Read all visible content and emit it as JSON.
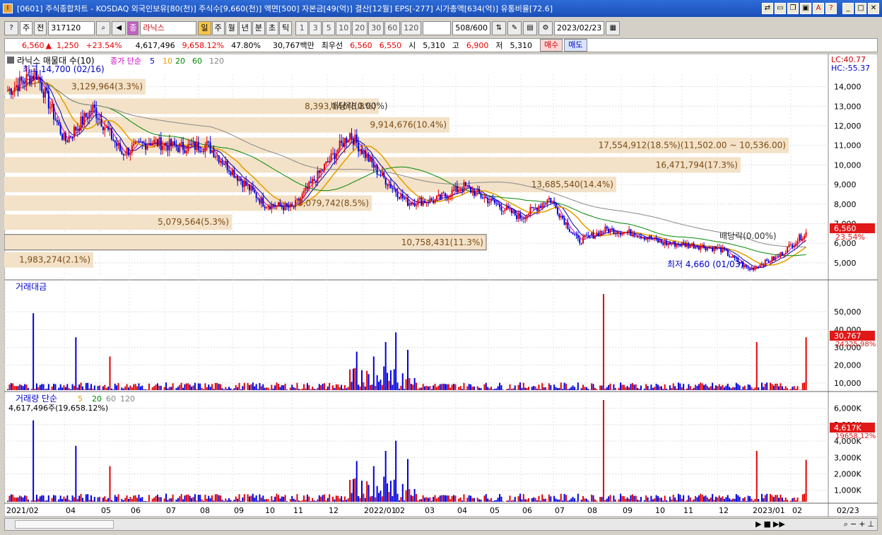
{
  "window": {
    "title": "[0601] 주식종합차트 - KOSDAQ 외국인보유[80(천)] 주식수[9,660(천)] 액면[500] 자본금[49(억)] 결산[12월] EPS[-277] 시가총액[634(억)] 유통비율[72.6]"
  },
  "toolbar": {
    "type_select": "주",
    "jeon_label": "전",
    "code_value": "317120",
    "stock_name": "라닉스",
    "stock_prefix": "종",
    "periods": [
      "일",
      "주",
      "월",
      "년",
      "분",
      "초",
      "틱"
    ],
    "selected_period": "일",
    "numbers": [
      "1",
      "3",
      "5",
      "10",
      "20",
      "30",
      "60",
      "120"
    ],
    "count_value": "508",
    "count_total": "/600",
    "date_value": "2023/02/23"
  },
  "quote": {
    "price": "6,560",
    "arrow": "▲",
    "change": "1,250",
    "change_pct": "+23.54%",
    "volume": "4,617,496",
    "volume_ratio": "9,658.12%",
    "turnover_pct": "47.80%",
    "amount": "30,767백만",
    "priority_label": "최우선",
    "ask": "6,560",
    "bid": "6,550",
    "open_label": "시",
    "open": "5,310",
    "high_label": "고",
    "high": "6,900",
    "low_label": "저",
    "low": "5,310",
    "buy_label": "매수",
    "sell_label": "매도"
  },
  "price_pane": {
    "title": "라닉스 매물대 수(10)",
    "ma_label": "종가 단순",
    "ma_periods": [
      "5",
      "10",
      "20",
      "60",
      "120"
    ],
    "lc": "LC:40.77",
    "hc": "HC:-55.37",
    "max_label": "최고 14,700 (02/16)",
    "min_label": "최저 4,660 (01/03)",
    "div_label_1": "배당락(0.00%)",
    "div_label_2": "배당락(0.00%)",
    "current_price_tag": "6,560",
    "current_pct_tag": "23.54%",
    "y_ticks": [
      "14,000",
      "13,000",
      "12,000",
      "11,000",
      "10,000",
      "9,000",
      "8,000",
      "7,000",
      "6,000",
      "5,000"
    ],
    "volume_profile": [
      {
        "label": "3,129,964(3.3%)"
      },
      {
        "label": "8,393,146(8.8%)"
      },
      {
        "label": "9,914,676(10.4%)"
      },
      {
        "label": "17,554,912(18.5%)(11,502.00 ~ 10,536.00)"
      },
      {
        "label": "16,471,794(17.3%)"
      },
      {
        "label": "13,685,540(14.4%)"
      },
      {
        "label": "8,079,742(8.5%)"
      },
      {
        "label": "5,079,564(5.3%)"
      },
      {
        "label": "10,758,431(11.3%)"
      },
      {
        "label": "1,983,274(2.1%)"
      }
    ]
  },
  "amount_pane": {
    "title": "거래대금",
    "y_ticks": [
      "50,000",
      "40,000",
      "30,000",
      "20,000",
      "10,000"
    ],
    "tag_value": "30,767",
    "tag_pct": "24225.98%"
  },
  "volume_pane": {
    "title": "거래량 단순",
    "ma_periods": [
      "5",
      "20",
      "60",
      "120"
    ],
    "sub": "4,617,496주(19,658.12%)",
    "y_ticks": [
      "6,000K",
      "5,000K",
      "4,000K",
      "3,000K",
      "2,000K",
      "1,000K"
    ],
    "tag_value": "4,617K",
    "tag_pct": "19658.12%"
  },
  "x_axis": {
    "labels": [
      "2021/02",
      "04",
      "05",
      "06",
      "07",
      "08",
      "09",
      "10",
      "11",
      "12",
      "2022/01",
      "02",
      "03",
      "04",
      "05",
      "06",
      "07",
      "08",
      "09",
      "10",
      "11",
      "12",
      "2023/01",
      "02"
    ],
    "right_label": "02/23"
  },
  "chart_data": {
    "type": "candlestick",
    "title": "라닉스",
    "price_range": [
      4660,
      14700
    ],
    "price_points": [
      {
        "date": "2021/02",
        "close": 13800
      },
      {
        "date": "2021/02/16",
        "close": 14700
      },
      {
        "date": "2021/03",
        "close": 11200
      },
      {
        "date": "2021/04",
        "close": 12900
      },
      {
        "date": "2021/05",
        "close": 10600
      },
      {
        "date": "2021/06",
        "close": 11200
      },
      {
        "date": "2021/07",
        "close": 10900
      },
      {
        "date": "2021/08",
        "close": 11000
      },
      {
        "date": "2021/09",
        "close": 9500
      },
      {
        "date": "2021/10",
        "close": 8000
      },
      {
        "date": "2021/11",
        "close": 7800
      },
      {
        "date": "2021/11b",
        "close": 9700
      },
      {
        "date": "2021/12",
        "close": 11600
      },
      {
        "date": "2022/01",
        "close": 9600
      },
      {
        "date": "2022/02",
        "close": 8100
      },
      {
        "date": "2022/03",
        "close": 8200
      },
      {
        "date": "2022/04",
        "close": 8900
      },
      {
        "date": "2022/05",
        "close": 8100
      },
      {
        "date": "2022/06",
        "close": 7300
      },
      {
        "date": "2022/06b",
        "close": 8300
      },
      {
        "date": "2022/07",
        "close": 6100
      },
      {
        "date": "2022/08",
        "close": 6700
      },
      {
        "date": "2022/09",
        "close": 6500
      },
      {
        "date": "2022/10",
        "close": 6000
      },
      {
        "date": "2022/11",
        "close": 5900
      },
      {
        "date": "2022/12",
        "close": 5700
      },
      {
        "date": "2023/01/03",
        "close": 4660
      },
      {
        "date": "2023/02",
        "close": 5300
      },
      {
        "date": "2023/02/23",
        "close": 6560
      }
    ],
    "ma": [
      "5",
      "10",
      "20",
      "60",
      "120"
    ]
  },
  "colors": {
    "up": "#e00000",
    "down": "#0000e0",
    "profile": "#f3e2c8",
    "accent": "#f6c44a"
  }
}
